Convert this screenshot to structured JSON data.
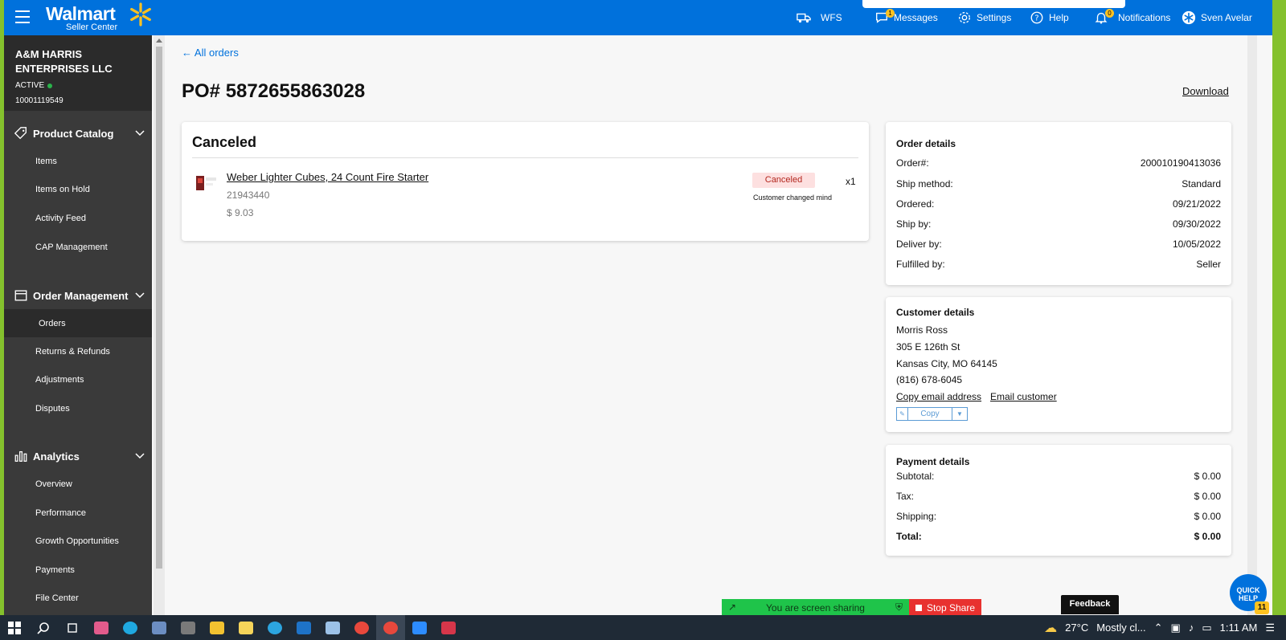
{
  "topbar": {
    "brand": "Walmart",
    "brand_sub": "Seller Center",
    "nav": [
      {
        "label": "WFS",
        "icon": "truck-icon"
      },
      {
        "label": "Messages",
        "icon": "chat-icon",
        "badge": "1"
      },
      {
        "label": "Settings",
        "icon": "gear-icon"
      },
      {
        "label": "Help",
        "icon": "help-icon"
      },
      {
        "label": "Notifications",
        "icon": "bell-icon",
        "badge": "0"
      },
      {
        "label": "Sven Avelar",
        "icon": "user-icon"
      }
    ]
  },
  "sidebar": {
    "org_name": "A&M HARRIS ENTERPRISES LLC",
    "org_status": "ACTIVE",
    "org_id": "10001119549",
    "sections": [
      {
        "label": "Product Catalog",
        "items": [
          "Items",
          "Items on Hold",
          "Activity Feed",
          "CAP Management"
        ]
      },
      {
        "label": "Order Management",
        "items": [
          "Orders",
          "Returns & Refunds",
          "Adjustments",
          "Disputes"
        ]
      },
      {
        "label": "Analytics",
        "items": [
          "Overview",
          "Performance",
          "Growth Opportunities",
          "Payments",
          "File Center"
        ]
      }
    ]
  },
  "main": {
    "back_link": "All orders",
    "po_title": "PO# 5872655863028",
    "download": "Download",
    "status_card": {
      "title": "Canceled",
      "item_name": "Weber Lighter Cubes, 24 Count Fire Starter",
      "item_sku": "21943440",
      "item_price": "$ 9.03",
      "status_pill": "Canceled",
      "reason": "Customer changed mind",
      "qty": "x1"
    },
    "order_details": {
      "title": "Order details",
      "rows": [
        {
          "label": "Order#:",
          "value": "200010190413036"
        },
        {
          "label": "Ship method:",
          "value": "Standard"
        },
        {
          "label": "Ordered:",
          "value": "09/21/2022"
        },
        {
          "label": "Ship by:",
          "value": "09/30/2022"
        },
        {
          "label": "Deliver by:",
          "value": "10/05/2022"
        },
        {
          "label": "Fulfilled by:",
          "value": "Seller"
        }
      ]
    },
    "customer_details": {
      "title": "Customer details",
      "name": "Morris Ross",
      "address1": "305 E 126th St",
      "address2": "Kansas City, MO 64145",
      "phone": "(816) 678-6045",
      "copy_email": "Copy email address",
      "email_customer": "Email customer",
      "copy_button": "Copy"
    },
    "payment_details": {
      "title": "Payment details",
      "rows": [
        {
          "label": "Subtotal:",
          "value": "$ 0.00"
        },
        {
          "label": "Tax:",
          "value": "$ 0.00"
        },
        {
          "label": "Shipping:",
          "value": "$ 0.00"
        },
        {
          "label": "Total:",
          "value": "$ 0.00"
        }
      ]
    }
  },
  "overlays": {
    "sharing_text": "You are screen sharing",
    "stop_share": "Stop Share",
    "feedback": "Feedback",
    "quick_help_line1": "QUICK",
    "quick_help_line2": "HELP",
    "quick_help_badge": "11"
  },
  "taskbar": {
    "weather": "27°C",
    "weather_desc": "Mostly cl...",
    "time": "1:11 AM"
  },
  "colors": {
    "walmart_blue": "#0071dc",
    "spark_yellow": "#ffc220",
    "sidebar_dark": "#3a3a3a",
    "canceled_pill": "#fde0e0"
  }
}
